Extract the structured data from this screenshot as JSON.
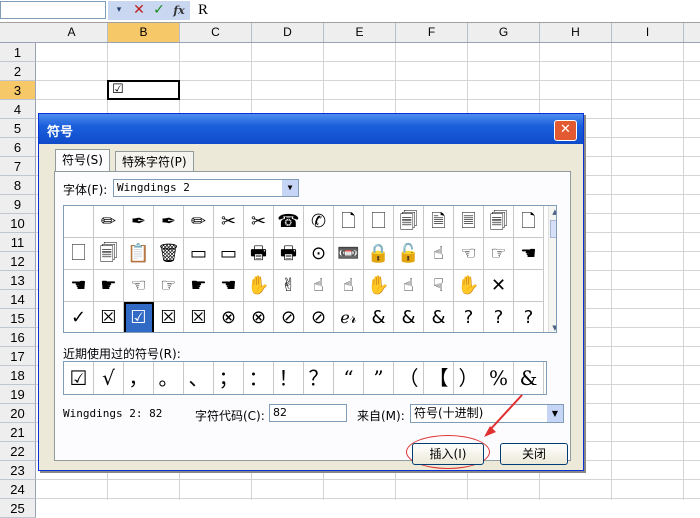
{
  "formula_bar": {
    "value": "R",
    "cancel_glyph": "✕",
    "enter_glyph": "✓",
    "fx_glyph": "fx",
    "dropdown_glyph": "▾"
  },
  "columns": [
    "A",
    "B",
    "C",
    "D",
    "E",
    "F",
    "G",
    "H",
    "I"
  ],
  "rows": [
    "1",
    "2",
    "3",
    "4",
    "5",
    "6",
    "7",
    "8",
    "9",
    "10",
    "11",
    "12",
    "13",
    "14",
    "15",
    "16",
    "17",
    "18",
    "19",
    "20",
    "21",
    "22",
    "23",
    "24",
    "25"
  ],
  "active_cell": {
    "value": "☑"
  },
  "dialog": {
    "title": "符号",
    "close_glyph": "✕",
    "tabs": [
      "符号(S)",
      "特殊字符(P)"
    ],
    "font_label": "字体(F):",
    "font_value": "Wingdings 2",
    "symbols": [
      [
        "",
        "✏",
        "✒",
        "✒",
        "✏",
        "✂",
        "✂",
        "☎",
        "✆",
        "🗋",
        "🗌",
        "🗐",
        "🗎",
        "🗏",
        "🗐",
        "🗋"
      ],
      [
        "🗌",
        "🗐",
        "📋",
        "🗑",
        "▭",
        "▭",
        "🖶",
        "🖶",
        "⊙",
        "📼",
        "🔒",
        "🔓",
        "☝",
        "☜",
        "☞",
        "☚"
      ],
      [
        "☚",
        "☛",
        "☜",
        "☞",
        "☛",
        "☚",
        "✋",
        "✌",
        "☝",
        "☝",
        "✋",
        "☝",
        "☟",
        "✋",
        "✕",
        ""
      ],
      [
        "✓",
        "☒",
        "☑",
        "☒",
        "☒",
        "⊗",
        "⊗",
        "⊘",
        "⊘",
        "ℯ𝓇",
        "&",
        "&",
        "&",
        "?",
        "?",
        "?"
      ]
    ],
    "recent_label": "近期使用过的符号(R):",
    "recent": [
      "☑",
      "√",
      "，",
      "。",
      "、",
      "；",
      "：",
      "！",
      "？",
      "“",
      "”",
      "（",
      "【",
      "）",
      "%",
      "&"
    ],
    "char_info": "Wingdings 2: 82",
    "code_label": "字符代码(C):",
    "code_value": "82",
    "from_label": "来自(M):",
    "from_value": "符号(十进制)",
    "insert_label": "插入(I)",
    "close_label": "关闭"
  },
  "colors": {
    "accent": "#316ac5",
    "titlebar": "#0f4bc9",
    "highlight": "#f7c868",
    "annotation": "#e03030"
  }
}
